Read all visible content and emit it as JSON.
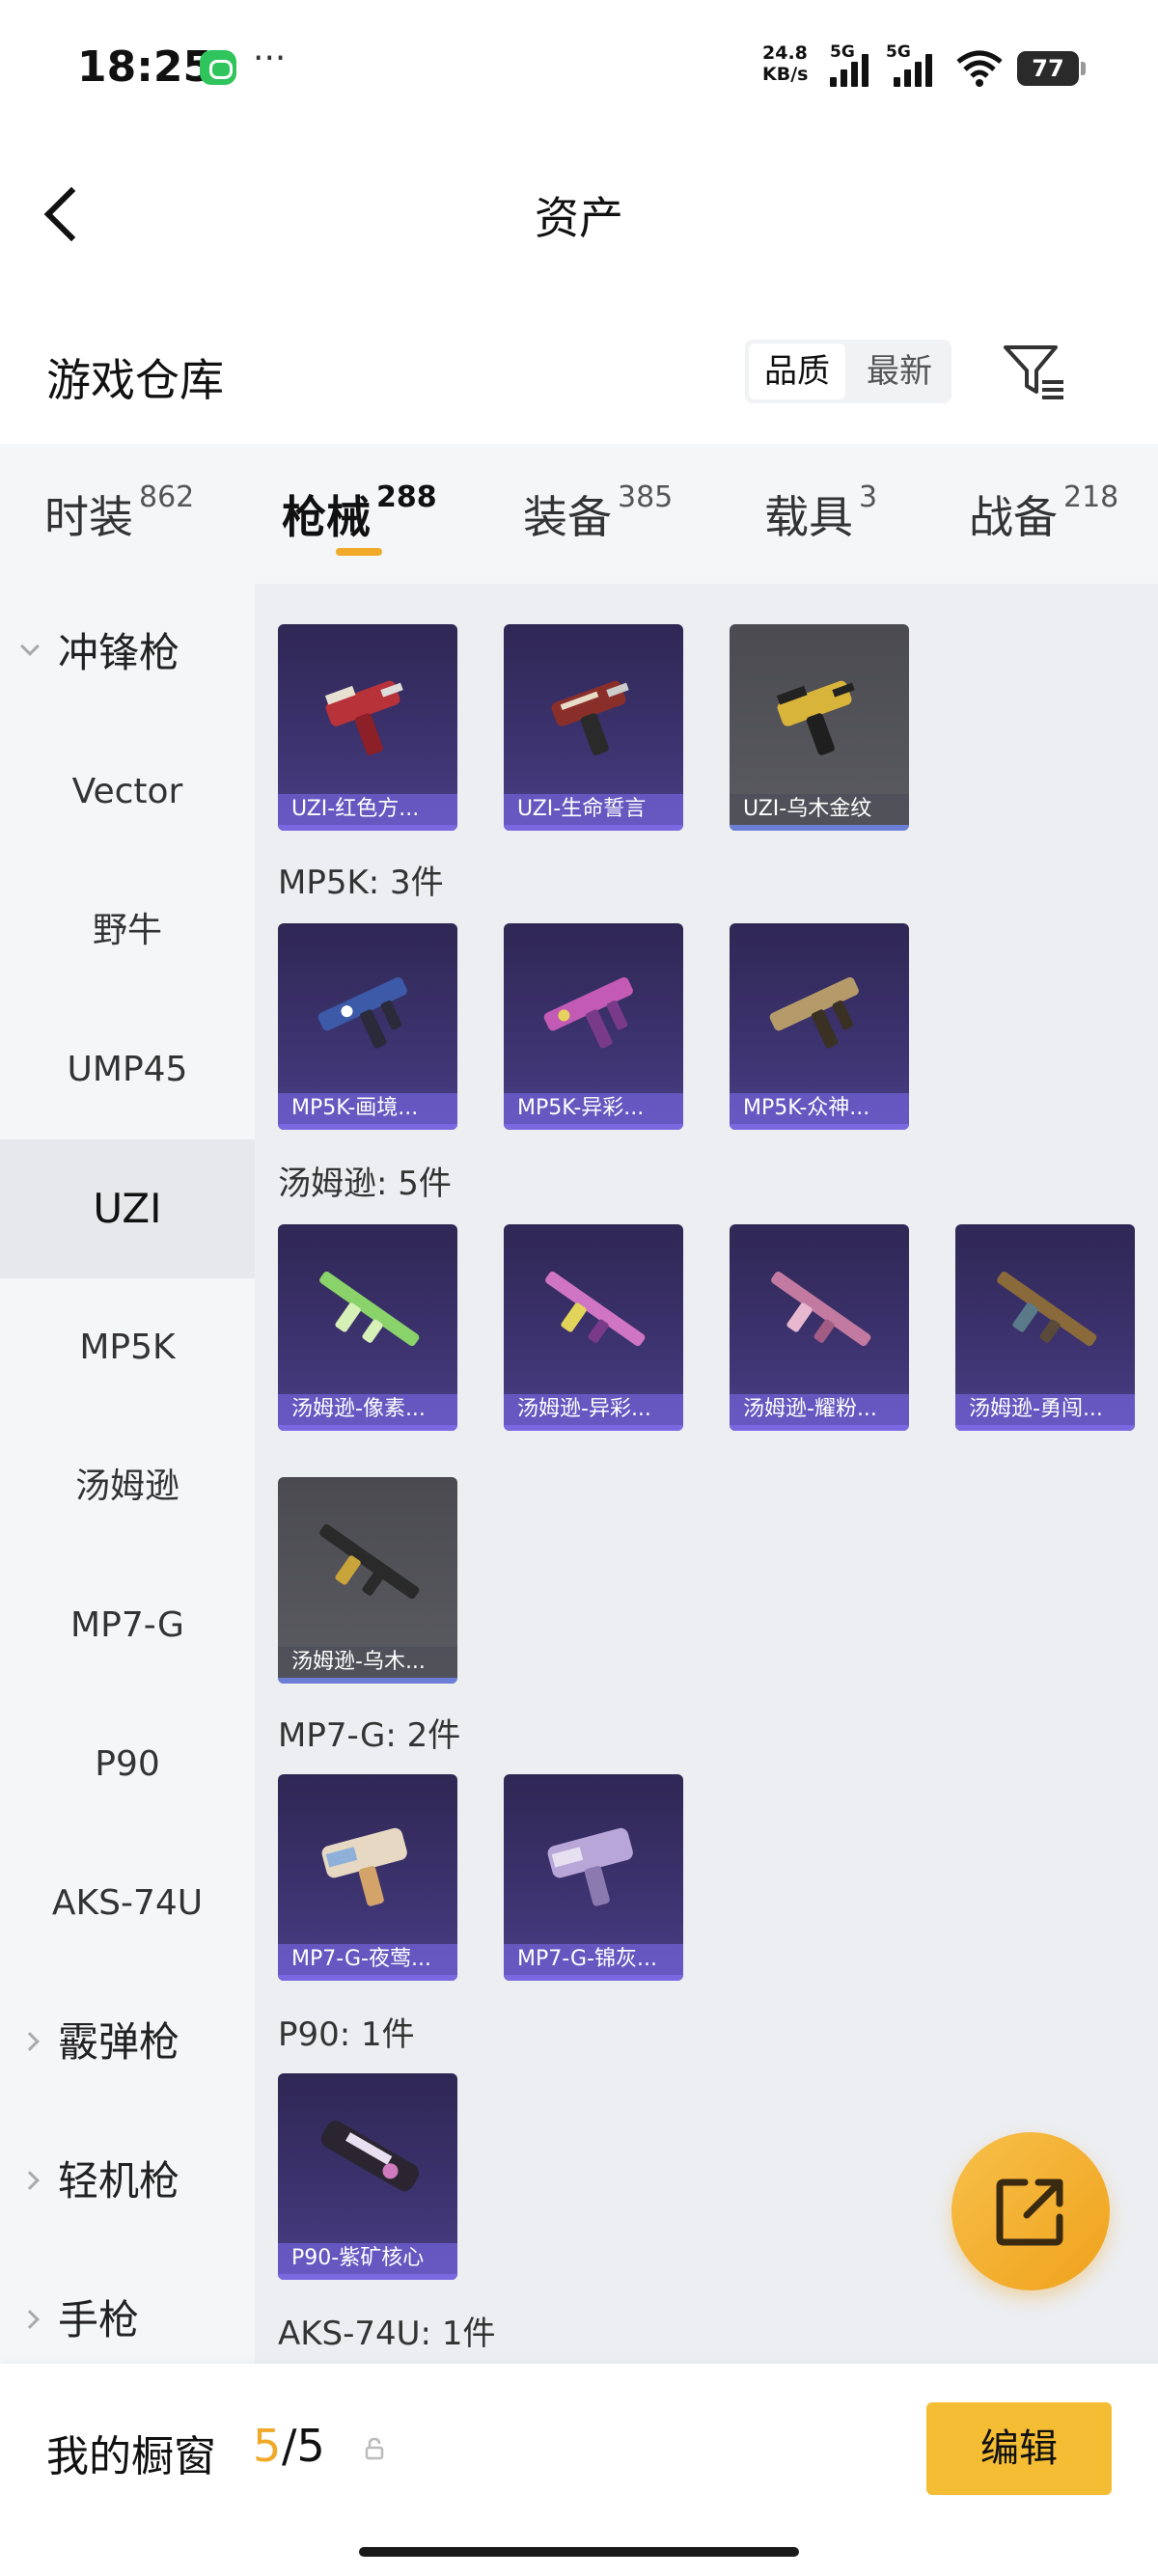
{
  "status": {
    "time": "18:25",
    "speed": "24.8",
    "speed_unit": "KB/s",
    "net1": "5G",
    "net2": "5G",
    "battery": "77"
  },
  "header": {
    "title": "资产"
  },
  "section": {
    "title": "游戏仓库",
    "sort_quality": "品质",
    "sort_newest": "最新"
  },
  "tabs": [
    {
      "label": "时装",
      "count": "862"
    },
    {
      "label": "枪械",
      "count": "288"
    },
    {
      "label": "装备",
      "count": "385"
    },
    {
      "label": "载具",
      "count": "3"
    },
    {
      "label": "战备",
      "count": "218"
    }
  ],
  "sidebar": {
    "group_open": "冲锋枪",
    "items": [
      "Vector",
      "野牛",
      "UMP45",
      "UZI",
      "MP5K",
      "汤姆逊",
      "MP7-G",
      "P90",
      "AKS-74U"
    ],
    "groups_closed": [
      "霰弹枪",
      "轻机枪",
      "手枪"
    ]
  },
  "content": {
    "uzi_cards": [
      "UZI-红色方...",
      "UZI-生命誓言",
      "UZI-乌木金纹"
    ],
    "mp5k_header": "MP5K: 3件",
    "mp5k_cards": [
      "MP5K-画境...",
      "MP5K-异彩...",
      "MP5K-众神..."
    ],
    "thompson_header": "汤姆逊: 5件",
    "thompson_cards": [
      "汤姆逊-像素...",
      "汤姆逊-异彩...",
      "汤姆逊-耀粉...",
      "汤姆逊-勇闯...",
      "汤姆逊-乌木..."
    ],
    "mp7_header": "MP7-G: 2件",
    "mp7_cards": [
      "MP7-G-夜莺...",
      "MP7-G-锦灰..."
    ],
    "p90_header": "P90: 1件",
    "p90_cards": [
      "P90-紫矿核心"
    ],
    "aks_header": "AKS-74U: 1件"
  },
  "bottom": {
    "label": "我的橱窗",
    "used": "5",
    "total": "/5",
    "edit_label": "编辑"
  },
  "colors": {
    "accent": "#f0a929",
    "card_bg": "#3d3370",
    "card_label": "#695ac8",
    "edit_button": "#f4bd33"
  }
}
